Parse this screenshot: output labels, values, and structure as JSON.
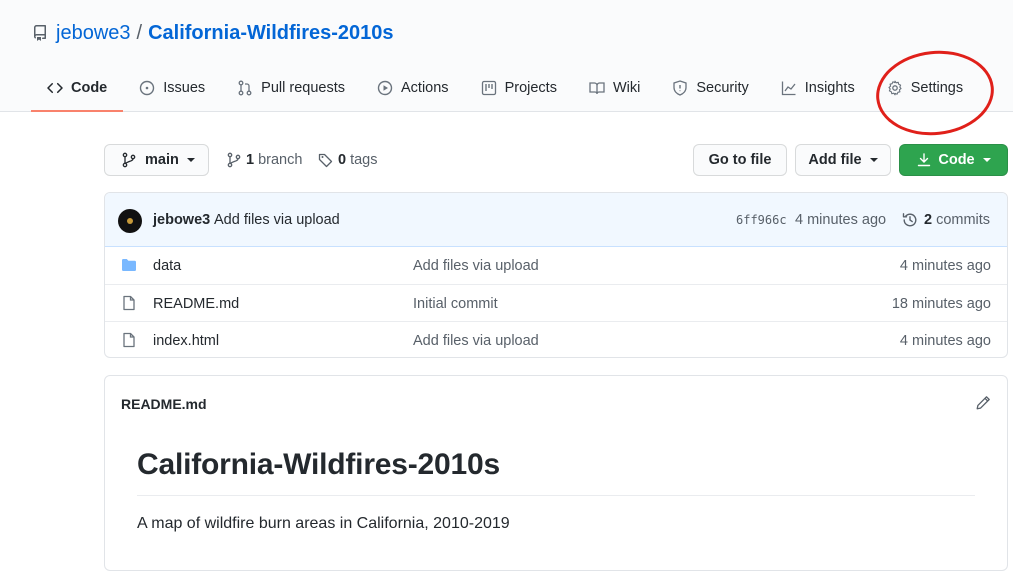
{
  "repo": {
    "owner": "jebowe3",
    "separator": "/",
    "name": "California-Wildfires-2010s"
  },
  "tabs": [
    {
      "label": "Code",
      "icon": "code-icon",
      "selected": true
    },
    {
      "label": "Issues",
      "icon": "issue-icon"
    },
    {
      "label": "Pull requests",
      "icon": "pull-request-icon"
    },
    {
      "label": "Actions",
      "icon": "play-icon"
    },
    {
      "label": "Projects",
      "icon": "project-icon"
    },
    {
      "label": "Wiki",
      "icon": "book-icon"
    },
    {
      "label": "Security",
      "icon": "shield-icon"
    },
    {
      "label": "Insights",
      "icon": "graph-icon"
    },
    {
      "label": "Settings",
      "icon": "gear-icon"
    }
  ],
  "toolbar": {
    "branch_label": "main",
    "branch_count": "1",
    "branch_word": "branch",
    "tag_count": "0",
    "tag_word": "tags",
    "goto_file": "Go to file",
    "add_file": "Add file",
    "code": "Code"
  },
  "commit": {
    "author": "jebowe3",
    "message": "Add files via upload",
    "sha": "6ff966c",
    "time": "4 minutes ago",
    "count": "2",
    "count_word": "commits"
  },
  "files": [
    {
      "name": "data",
      "type": "folder",
      "message": "Add files via upload",
      "age": "4 minutes ago"
    },
    {
      "name": "README.md",
      "type": "file",
      "message": "Initial commit",
      "age": "18 minutes ago"
    },
    {
      "name": "index.html",
      "type": "file",
      "message": "Add files via upload",
      "age": "4 minutes ago"
    }
  ],
  "readme": {
    "file_title": "README.md",
    "heading": "California-Wildfires-2010s",
    "paragraph": "A map of wildfire burn areas in California, 2010-2019"
  },
  "colors": {
    "accent_link": "#0366d6",
    "selected_tab_underline": "#f9826c",
    "code_button": "#2ea44f",
    "annotation_circle": "#e0201a"
  }
}
